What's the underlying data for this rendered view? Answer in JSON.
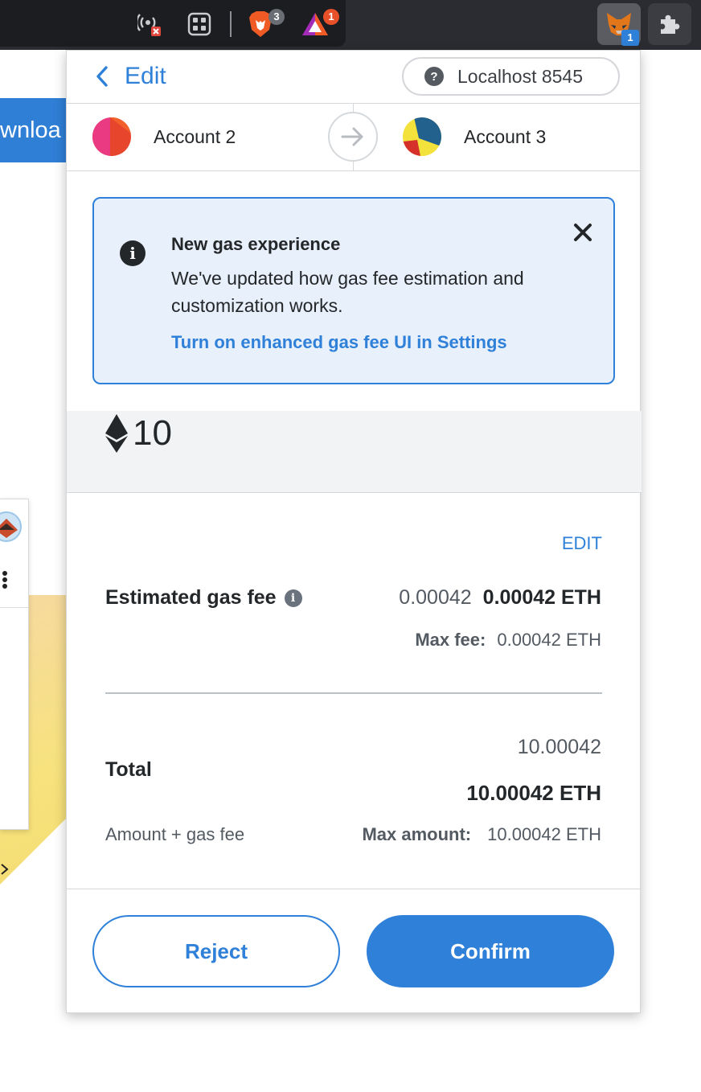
{
  "toolbar": {
    "extensions": [
      {
        "name": "wireless-icon"
      },
      {
        "name": "qr-grid-icon"
      },
      {
        "name": "brave-lion-icon",
        "badge": "3"
      },
      {
        "name": "brave-rewards-icon",
        "badge": "1"
      },
      {
        "name": "metamask-fox-icon",
        "badge": "1"
      },
      {
        "name": "puzzle-icon"
      }
    ]
  },
  "background": {
    "download_label": "wnloa"
  },
  "header": {
    "back_label": "Edit",
    "network_help": "?",
    "network_label": "Localhost 8545"
  },
  "accounts": {
    "from": "Account 2",
    "to": "Account 3"
  },
  "notice": {
    "title": "New gas experience",
    "body": "We've updated how gas fee estimation and customization works.",
    "link": "Turn on enhanced gas fee UI in Settings"
  },
  "amount": {
    "value": "10"
  },
  "gas": {
    "edit_label": "EDIT",
    "label": "Estimated gas fee",
    "value": "0.00042",
    "value_eth": "0.00042 ETH",
    "max_fee_label": "Max fee:",
    "max_fee_value": "0.00042 ETH"
  },
  "total": {
    "label": "Total",
    "value": "10.00042",
    "value_eth": "10.00042 ETH",
    "sub_label": "Amount + gas fee",
    "max_amount_label": "Max amount:",
    "max_amount_value": "10.00042 ETH"
  },
  "actions": {
    "reject": "Reject",
    "confirm": "Confirm"
  },
  "colors": {
    "accent": "#2f80d8",
    "notice_bg": "#e8f0fb",
    "text": "#24272a"
  }
}
